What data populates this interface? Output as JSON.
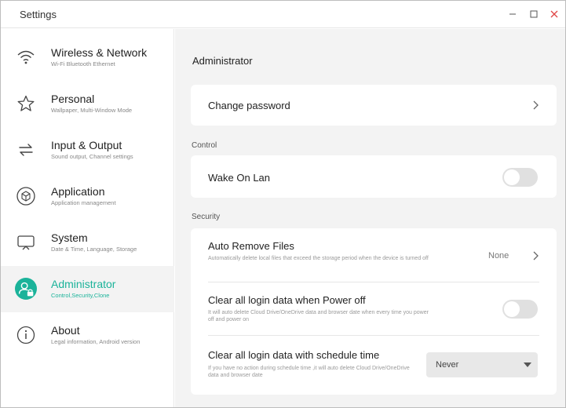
{
  "window": {
    "title": "Settings"
  },
  "sidebar": {
    "items": [
      {
        "title": "Wireless & Network",
        "subtitle": "Wi-Fi Bluetooth Ethernet",
        "icon": "wifi-icon"
      },
      {
        "title": "Personal",
        "subtitle": "Wallpaper, Multi-Window Mode",
        "icon": "star-icon"
      },
      {
        "title": "Input & Output",
        "subtitle": "Sound output, Channel settings",
        "icon": "swap-arrows-icon"
      },
      {
        "title": "Application",
        "subtitle": "Application management",
        "icon": "cube-icon"
      },
      {
        "title": "System",
        "subtitle": "Date & Time, Language, Storage",
        "icon": "monitor-icon"
      },
      {
        "title": "Administrator",
        "subtitle": "Control,Security,Clone",
        "icon": "admin-lock-icon",
        "active": true
      },
      {
        "title": "About",
        "subtitle": "Legal information, Android version",
        "icon": "info-icon"
      }
    ]
  },
  "main": {
    "page_title": "Administrator",
    "change_password": {
      "label": "Change password"
    },
    "control": {
      "section_title": "Control",
      "wake_on_lan": {
        "label": "Wake On Lan",
        "enabled": false
      }
    },
    "security": {
      "section_title": "Security",
      "auto_remove": {
        "label": "Auto Remove Files",
        "description": "Automatically delete local files that exceed the storage period when the device is turned off",
        "value": "None"
      },
      "clear_power_off": {
        "label": "Clear all login data when Power off",
        "description": "It will auto delete Cloud Drive/OneDrive data and browser date when every time you power off and power on",
        "enabled": false
      },
      "clear_schedule": {
        "label": "Clear all login data with schedule time",
        "description": "If you have no action during schedule time ,it will auto delete Cloud Drive/OneDrive data and browser date",
        "selected": "Never"
      }
    }
  },
  "colors": {
    "accent": "#1bb39a",
    "close": "#e04848",
    "background": "#f3f3f3"
  }
}
